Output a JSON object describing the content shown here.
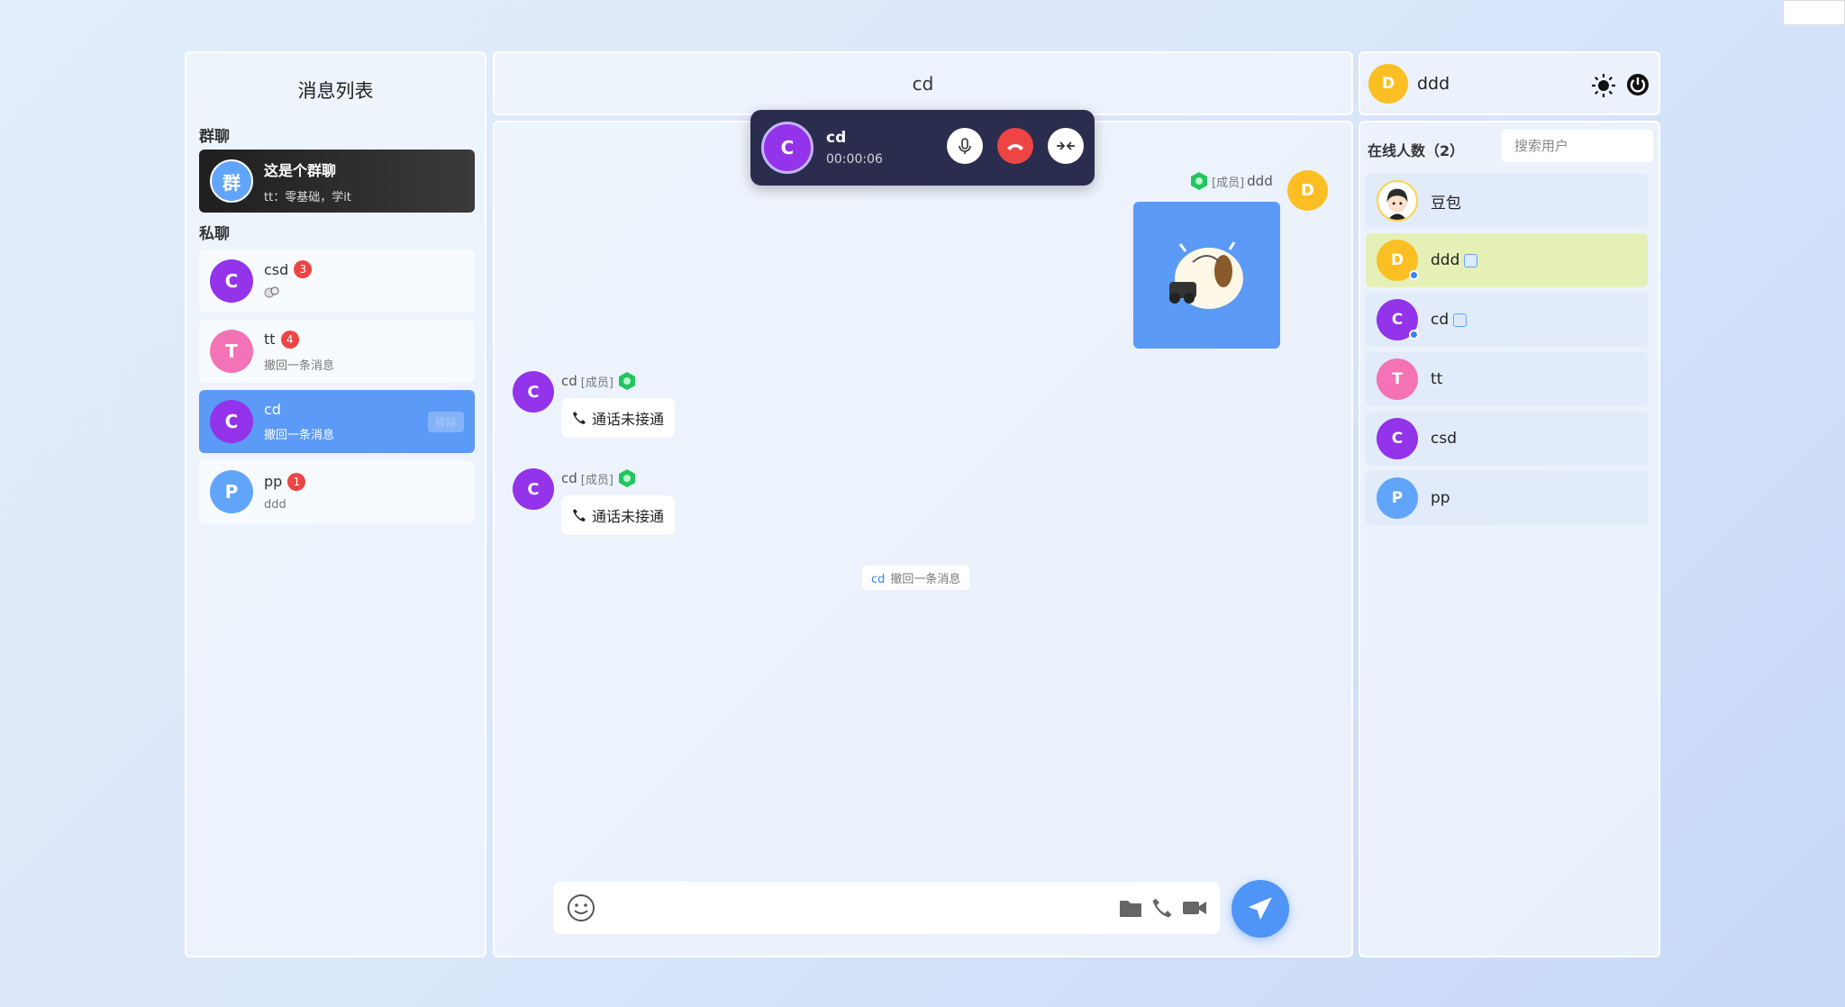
{
  "left": {
    "title": "消息列表",
    "group_section": "群聊",
    "private_section": "私聊",
    "group": {
      "avatar": "群",
      "name": "这是个群聊",
      "last": "tt：零基础，学it"
    },
    "chats": [
      {
        "avatar": "C",
        "name": "csd",
        "badge": "3",
        "last": "",
        "color": "#9333ea"
      },
      {
        "avatar": "T",
        "name": "tt",
        "badge": "4",
        "last": "撤回一条消息",
        "color": "#f472b6"
      },
      {
        "avatar": "C",
        "name": "cd",
        "badge": "",
        "last": "撤回一条消息",
        "color": "#9333ea",
        "action": "移除"
      },
      {
        "avatar": "P",
        "name": "pp",
        "badge": "1",
        "last": "ddd",
        "color": "#60a5fa"
      }
    ]
  },
  "chat": {
    "title": "cd",
    "call": {
      "avatar": "C",
      "name": "cd",
      "time": "00:00:06"
    },
    "me": {
      "name": "ddd",
      "role": "[成员]",
      "avatar": "D"
    },
    "messages": [
      {
        "avatar": "C",
        "name": "cd",
        "role": "[成员]",
        "text": "通话未接通"
      },
      {
        "avatar": "C",
        "name": "cd",
        "role": "[成员]",
        "text": "通话未接通"
      }
    ],
    "recall": {
      "who": "cd",
      "text": "撤回一条消息"
    }
  },
  "right": {
    "me": {
      "avatar": "D",
      "name": "ddd"
    },
    "online_label": "在线人数（2）",
    "search_placeholder": "搜索用户",
    "users": [
      {
        "avatar": "",
        "name": "豆包"
      },
      {
        "avatar": "D",
        "name": "ddd"
      },
      {
        "avatar": "C",
        "name": "cd"
      },
      {
        "avatar": "T",
        "name": "tt"
      },
      {
        "avatar": "C",
        "name": "csd"
      },
      {
        "avatar": "P",
        "name": "pp"
      }
    ]
  },
  "colors": {
    "accent": "#5b9af7",
    "danger": "#ef4444",
    "member": "#22c55e",
    "call_bg": "#2b2d4f"
  }
}
